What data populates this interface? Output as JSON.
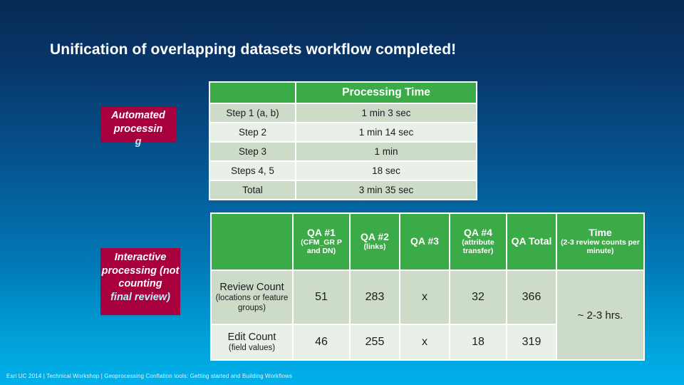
{
  "slide": {
    "title": "Unification of overlapping datasets workflow completed!",
    "footer": "Esri UC 2014 | Technical Workshop |  Geoprocessing Conflation tools: Getting started and Building Workflows",
    "colors": {
      "background_top": "#072a55",
      "background_bottom": "#00b0ea",
      "label_red": "#a8003c",
      "header_green": "#3aab46",
      "row_band_dark": "#ccdcc9",
      "row_band_light": "#e9f0e7",
      "overflow_text": "#b9f0ff"
    }
  },
  "labels": {
    "automated": {
      "boxed_text": "Automated processin",
      "overflow_text": "g"
    },
    "interactive": {
      "boxed_text": "Interactive processing (not counting",
      "overflow_text": "final review)"
    }
  },
  "processing_table": {
    "headers": [
      "",
      "Processing Time"
    ],
    "rows": [
      {
        "step": "Step 1 (a, b)",
        "time": "1 min 3 sec"
      },
      {
        "step": "Step 2",
        "time": "1 min 14 sec"
      },
      {
        "step": "Step 3",
        "time": "1 min"
      },
      {
        "step": "Steps 4, 5",
        "time": "18 sec"
      },
      {
        "step": "Total",
        "time": "3 min 35 sec"
      }
    ]
  },
  "qa_table": {
    "headers": [
      {
        "main": "",
        "sub": ""
      },
      {
        "main": "QA #1",
        "sub": "(CFM_GR P and DN)"
      },
      {
        "main": "QA #2",
        "sub": "(links)"
      },
      {
        "main": "QA #3",
        "sub": ""
      },
      {
        "main": "QA #4",
        "sub": "(attribute transfer)"
      },
      {
        "main": "QA Total",
        "sub": ""
      },
      {
        "main": "Time",
        "sub": "(2-3 review counts per minute)"
      }
    ],
    "rows": [
      {
        "label_main": "Review Count",
        "label_sub": "(locations or feature groups)",
        "qa1": "51",
        "qa2": "283",
        "qa3": "x",
        "qa4": "32",
        "qa_total": "366"
      },
      {
        "label_main": "Edit Count",
        "label_sub": "(field values)",
        "qa1": "46",
        "qa2": "255",
        "qa3": "x",
        "qa4": "18",
        "qa_total": "319"
      }
    ],
    "time_value": "~ 2-3 hrs."
  }
}
